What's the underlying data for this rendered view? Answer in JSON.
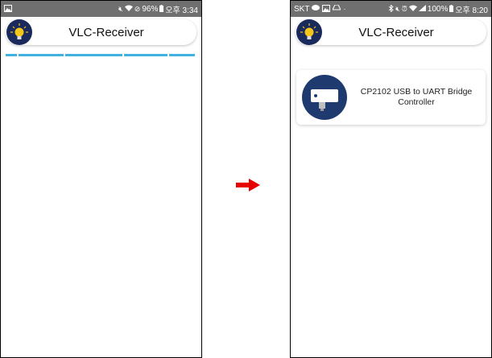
{
  "left_screen": {
    "status": {
      "battery": "96%",
      "time": "오후 3:34"
    },
    "app_title": "VLC-Receiver",
    "progress_segments": 5
  },
  "right_screen": {
    "status": {
      "carrier": "SKT",
      "battery": "100%",
      "time": "오후 8:20"
    },
    "app_title": "VLC-Receiver",
    "device": {
      "name": "CP2102 USB to UART Bridge Controller"
    }
  },
  "colors": {
    "status_bar": "#6f6f6f",
    "progress": "#3fb2e0",
    "logo_bg": "#1b2a5c",
    "arrow": "#e60000"
  },
  "icons": {
    "logo": "lightbulb-icon",
    "device": "usb-adapter-icon",
    "transition": "arrow-right-icon"
  }
}
